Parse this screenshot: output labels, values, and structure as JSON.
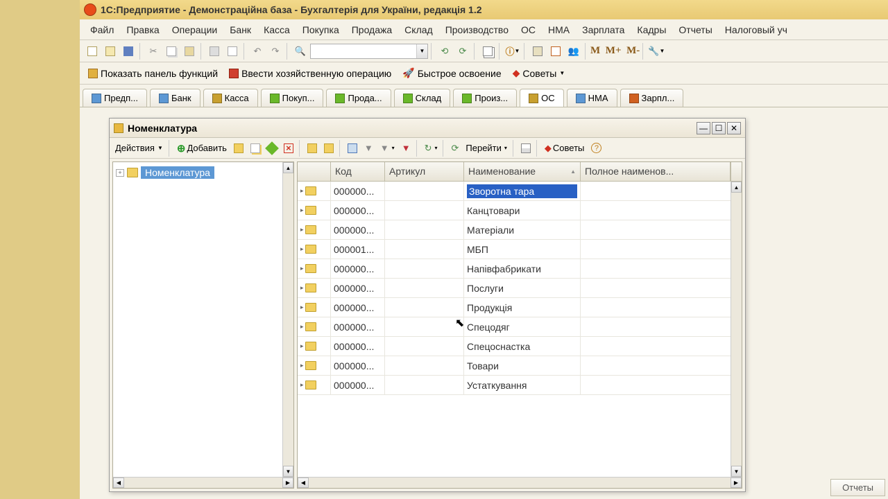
{
  "title": "1С:Предприятие - Демонстраційна база - Бухгалтерія для України, редакція 1.2",
  "menu": [
    "Файл",
    "Правка",
    "Операции",
    "Банк",
    "Касса",
    "Покупка",
    "Продажа",
    "Склад",
    "Производство",
    "ОС",
    "НМА",
    "Зарплата",
    "Кадры",
    "Отчеты",
    "Налоговый уч"
  ],
  "toolbar2": {
    "show_panel": "Показать панель функций",
    "enter_op": "Ввести хозяйственную операцию",
    "quick_start": "Быстрое освоение",
    "tips": "Советы"
  },
  "m_letters": [
    "M",
    "M+",
    "M-"
  ],
  "tabs": [
    {
      "label": "Предп...",
      "ico": "#5d98d4"
    },
    {
      "label": "Банк",
      "ico": "#5d98d4"
    },
    {
      "label": "Касса",
      "ico": "#c8a030"
    },
    {
      "label": "Покуп...",
      "ico": "#6ab82a"
    },
    {
      "label": "Прода...",
      "ico": "#6ab82a"
    },
    {
      "label": "Склад",
      "ico": "#6ab82a"
    },
    {
      "label": "Произ...",
      "ico": "#6ab82a"
    },
    {
      "label": "ОС",
      "active": true,
      "ico": "#c8a030"
    },
    {
      "label": "НМА",
      "ico": "#5d98d4"
    },
    {
      "label": "Зарпл...",
      "ico": "#d06020"
    }
  ],
  "reports_btn": "Отчеты",
  "window": {
    "title": "Номенклатура",
    "actions": "Действия",
    "add": "Добавить",
    "go": "Перейти",
    "tips": "Советы",
    "tree_root": "Номенклатура",
    "columns": {
      "code": "Код",
      "article": "Артикул",
      "name": "Наименование",
      "full": "Полное наименов..."
    },
    "rows": [
      {
        "code": "000000...",
        "art": "",
        "name": "Зворотна тара",
        "selected": true
      },
      {
        "code": "000000...",
        "art": "",
        "name": "Канцтовари"
      },
      {
        "code": "000000...",
        "art": "",
        "name": "Матеріали"
      },
      {
        "code": "000001...",
        "art": "",
        "name": "МБП"
      },
      {
        "code": "000000...",
        "art": "",
        "name": "Напівфабрикати"
      },
      {
        "code": "000000...",
        "art": "",
        "name": "Послуги"
      },
      {
        "code": "000000...",
        "art": "",
        "name": "Продукція"
      },
      {
        "code": "000000...",
        "art": "",
        "name": "Спецодяг"
      },
      {
        "code": "000000...",
        "art": "",
        "name": "Спецоснастка"
      },
      {
        "code": "000000...",
        "art": "",
        "name": "Товари"
      },
      {
        "code": "000000...",
        "art": "",
        "name": "Устаткування"
      }
    ]
  }
}
